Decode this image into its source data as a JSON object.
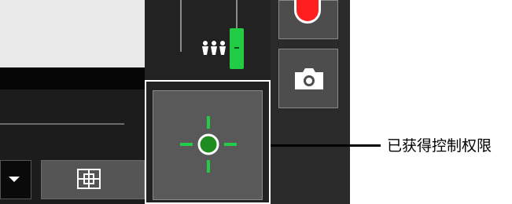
{
  "callout": {
    "text": "已获得控制权限"
  },
  "icons": {
    "dropdown": "chevron-down-icon",
    "grid": "grid-icon",
    "focus": "focus-target-icon",
    "record": "record-icon",
    "snapshot": "camera-icon",
    "level": "people-icon"
  },
  "colors": {
    "accent_green": "#22cc44",
    "record_red": "#ff1f1f",
    "button_gray": "#555555"
  }
}
